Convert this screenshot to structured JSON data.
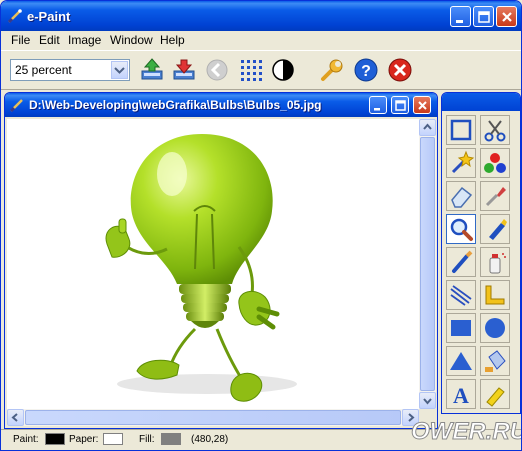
{
  "app": {
    "title": "e-Paint"
  },
  "menu": {
    "items": [
      "File",
      "Edit",
      "Image",
      "Window",
      "Help"
    ]
  },
  "toolbar": {
    "zoom_value": "25 percent",
    "buttons": [
      "import-icon",
      "export-icon",
      "back-icon",
      "grid-icon",
      "contrast-icon",
      "wrench-icon",
      "help-icon",
      "close-red-icon"
    ]
  },
  "document": {
    "title": "D:\\Web-Developing\\webGrafika\\Bulbs\\Bulbs_05.jpg"
  },
  "tools": {
    "items": [
      "rectangle-select-icon",
      "scissors-icon",
      "magic-wand-icon",
      "color-circles-icon",
      "eraser-icon",
      "eyedropper-icon",
      "magnifier-icon",
      "marker-icon",
      "brush-icon",
      "spray-can-icon",
      "line-icon",
      "ruler-icon",
      "rectangle-icon",
      "ellipse-icon",
      "triangle-icon",
      "fill-bucket-icon",
      "text-icon",
      "highlighter-icon"
    ]
  },
  "status": {
    "paint_label": "Paint:",
    "paper_label": "Paper:",
    "fill_label": "Fill:",
    "paint_color": "#000000",
    "paper_color": "#ffffff",
    "fill_color": "#808080",
    "coords": "(480,28)"
  },
  "watermark": "OWER.RU",
  "colors": {
    "accent": "#0a5ce8",
    "bulb_green": "#9ad11b"
  }
}
